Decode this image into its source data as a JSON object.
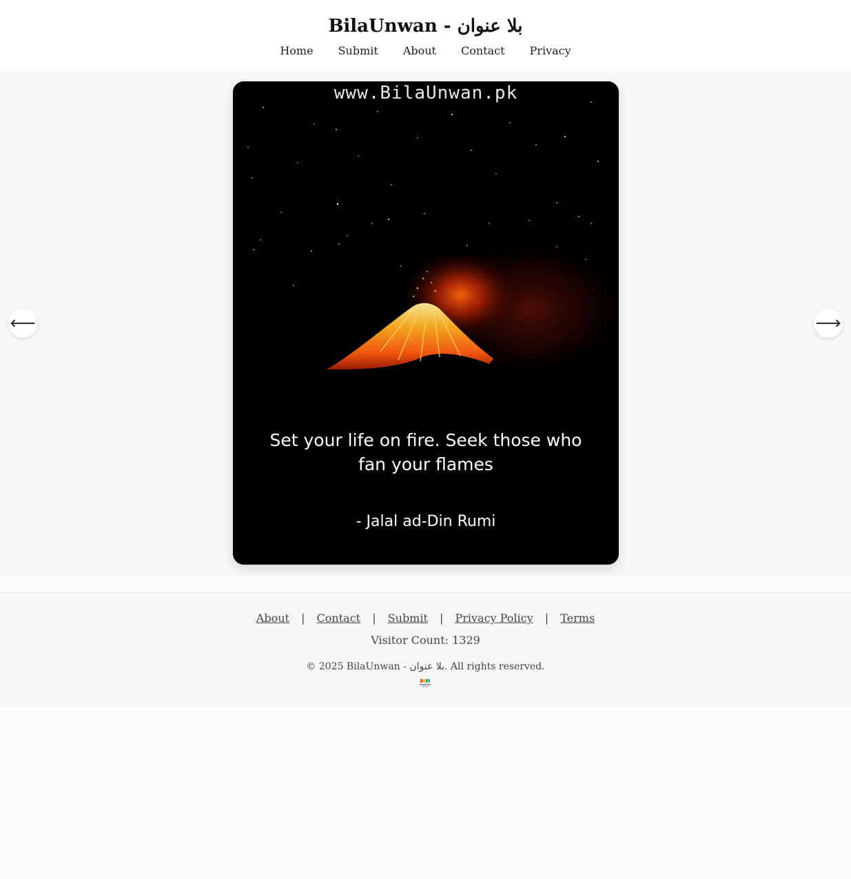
{
  "header": {
    "title": "BilaUnwan - بلا عنوان",
    "nav": [
      "Home",
      "Submit",
      "About",
      "Contact",
      "Privacy"
    ]
  },
  "slide": {
    "watermark": "www.BilaUnwan.pk",
    "quote": "Set your life on fire. Seek those who fan your flames",
    "author": "- Jalal ad-Din Rumi",
    "image_icon": "volcano-eruption-image"
  },
  "carousel": {
    "prev_icon": "arrow-left-icon",
    "prev_glyph": "⟵",
    "next_icon": "arrow-right-icon",
    "next_glyph": "⟶"
  },
  "footer": {
    "links": [
      "About",
      "Contact",
      "Submit",
      "Privacy Policy",
      "Terms"
    ],
    "separator": "|",
    "visitor_count": "Visitor Count: 1329",
    "copyright": "© 2025 BilaUnwan - بلا عنوان. All rights reserved.",
    "logo_icon": "site-logo-icon"
  },
  "colors": {
    "header_bg": "#ffffff",
    "stage_bg": "#f6f7f8",
    "card_bg": "#000000",
    "lava": "#ff5a10",
    "text": "#222222"
  }
}
